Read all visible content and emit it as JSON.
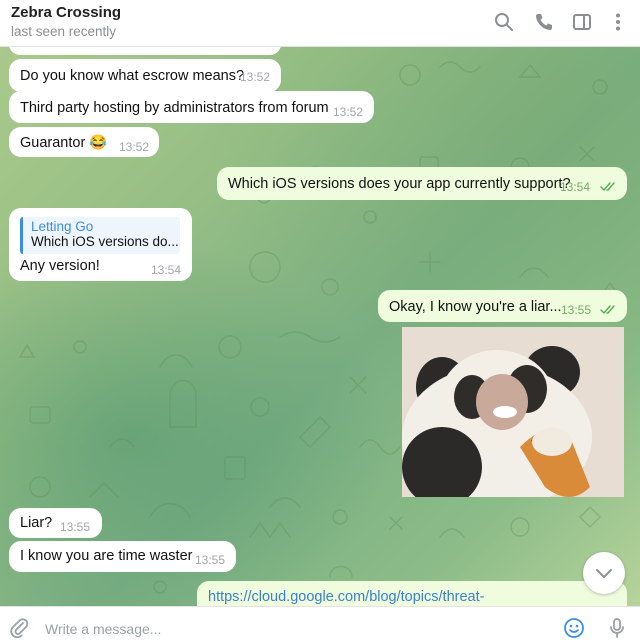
{
  "header": {
    "title": "Zebra Crossing",
    "status": "last seen recently"
  },
  "messages": [
    {
      "text": "Do you know what escrow means?",
      "time": "13:52",
      "direction": "incoming"
    },
    {
      "text": "Third party hosting by administrators from forum",
      "time": "13:52",
      "direction": "incoming"
    },
    {
      "text": "Guarantor 😂",
      "time": "13:52",
      "direction": "incoming"
    },
    {
      "text": "Which iOS versions does your app currently support?",
      "time": "13:54",
      "direction": "outgoing",
      "read": true
    },
    {
      "reply_name": "Letting Go",
      "reply_text": "Which iOS versions do...",
      "text": "Any version!",
      "time": "13:54",
      "direction": "incoming"
    },
    {
      "text": "Okay, I know you're a liar...",
      "time": "13:55",
      "direction": "outgoing",
      "read": true
    },
    {
      "text": "Liar?",
      "time": "13:55",
      "direction": "incoming"
    },
    {
      "text": "I know you are time waster",
      "time": "13:55",
      "direction": "incoming"
    },
    {
      "text": "https://cloud.google.com/blog/topics/threat-",
      "direction": "outgoing"
    }
  ],
  "input": {
    "placeholder": "Write a message..."
  },
  "icons": {
    "search": "search-icon",
    "call": "phone-icon",
    "sidebar": "sidebar-toggle-icon",
    "more": "more-vertical-icon",
    "attach": "paperclip-icon",
    "emoji": "emoji-icon",
    "mic": "microphone-icon",
    "scroll": "chevron-down-icon"
  },
  "colors": {
    "incoming_bubble": "#ffffff",
    "outgoing_bubble": "#effdde",
    "accent": "#3a8ee6",
    "read_check": "#4fae4e"
  }
}
